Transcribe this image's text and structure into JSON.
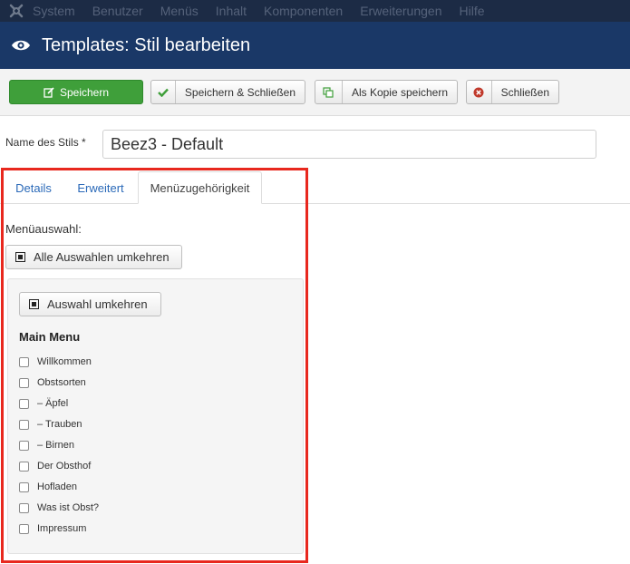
{
  "menubar": {
    "items": [
      "System",
      "Benutzer",
      "Menüs",
      "Inhalt",
      "Komponenten",
      "Erweiterungen",
      "Hilfe"
    ]
  },
  "header": {
    "title": "Templates: Stil bearbeiten"
  },
  "toolbar": {
    "save_label": "Speichern",
    "save_close_label": "Speichern & Schließen",
    "save_copy_label": "Als Kopie speichern",
    "close_label": "Schließen"
  },
  "form": {
    "style_name_label": "Name des Stils *",
    "style_name_value": "Beez3 - Default"
  },
  "tabs": [
    "Details",
    "Erweitert",
    "Menüzugehörigkeit"
  ],
  "menu_assignment": {
    "label": "Menüauswahl:",
    "toggle_all_label": "Alle Auswahlen umkehren",
    "toggle_label": "Auswahl umkehren",
    "menu_title": "Main Menu",
    "items": [
      "Willkommen",
      "Obstsorten",
      "– Äpfel",
      "– Trauben",
      "– Birnen",
      "Der Obsthof",
      "Hofladen",
      "Was ist Obst?",
      "Impressum"
    ]
  },
  "colors": {
    "menubar_bg": "#1c2b45",
    "titlebar_bg": "#1a3867",
    "save_button": "#3f9f3a",
    "link_blue": "#2a69b8",
    "highlight_red": "#e8281e"
  }
}
